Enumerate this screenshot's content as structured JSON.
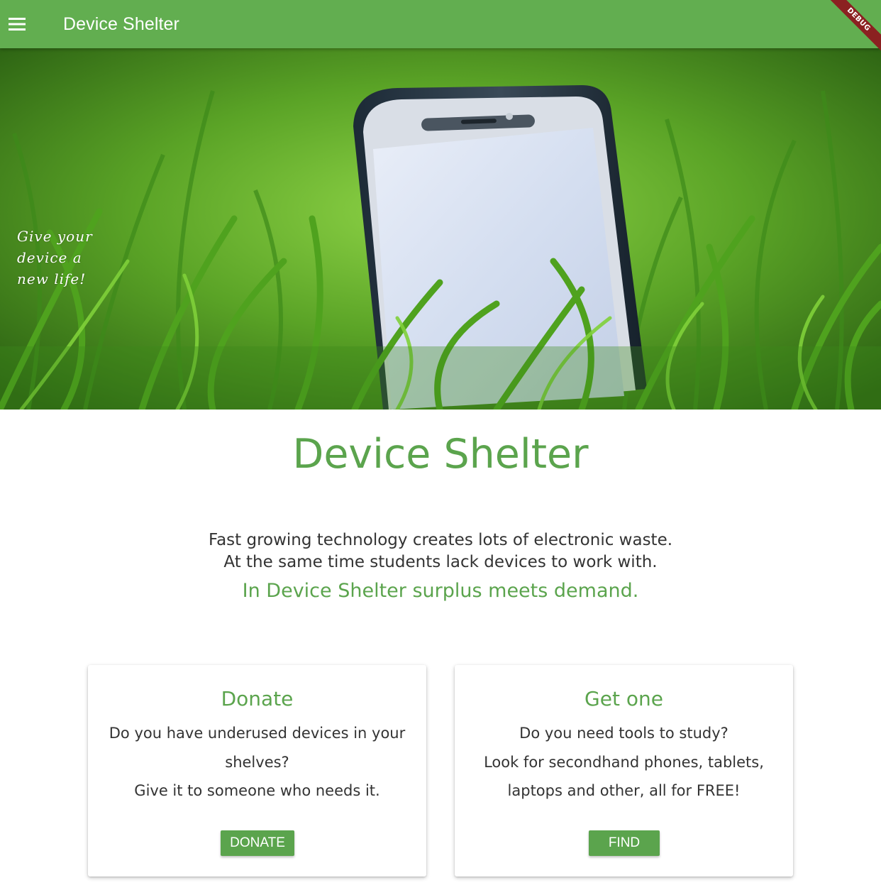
{
  "appbar": {
    "title": "Device Shelter",
    "menu_icon": "hamburger-menu-icon",
    "debug_label": "DEBUG",
    "color": "#62ae50"
  },
  "hero": {
    "tagline": "Give your\ndevice a\nnew life!",
    "image": "phone-in-grass"
  },
  "main": {
    "title": "Device Shelter",
    "intro_line1": "Fast growing technology creates lots of electronic waste.",
    "intro_line2": "At the same time students lack devices to work with.",
    "intro_accent": "In Device Shelter surplus meets demand.",
    "accent_color": "#5ba44d"
  },
  "cards": [
    {
      "title": "Donate",
      "body": "Do you have underused devices in your shelves?\nGive it to someone who needs it.",
      "button": "DONATE"
    },
    {
      "title": "Get one",
      "body": "Do you need tools to study?\nLook for secondhand phones, tablets, laptops and other, all for FREE!",
      "button": "FIND"
    }
  ]
}
